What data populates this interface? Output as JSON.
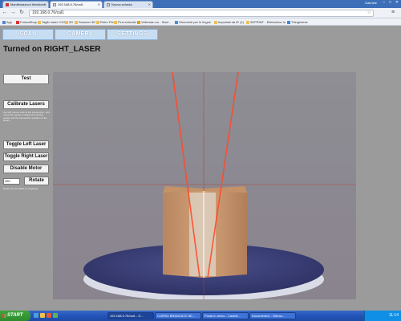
{
  "browser": {
    "tabs": [
      {
        "label": "Manifestazioni fieristiche"
      },
      {
        "label": "192.168.0.76/cal1"
      },
      {
        "label": "Nuova scheda"
      }
    ],
    "user_label": "Gabriele",
    "window_controls": {
      "minimize": "–",
      "maximize": "□",
      "close": "✕"
    },
    "url": "192.168.0.76/cal1",
    "bookmarks": [
      {
        "label": "App"
      },
      {
        "label": "FuturaShop"
      },
      {
        "label": "Taglio laser CO2"
      },
      {
        "label": "3D"
      },
      {
        "label": "Scanner 3D"
      },
      {
        "label": "Retro Pie"
      },
      {
        "label": "PLA extruder"
      },
      {
        "label": "Velleman.eu - Start -"
      },
      {
        "label": "Strumenti per le lingue"
      },
      {
        "label": "Importati da IE (1)"
      },
      {
        "label": "3DPRINT - Elettronica In"
      },
      {
        "label": "Thingiverse"
      }
    ]
  },
  "page": {
    "nav": {
      "scan": "SCAN",
      "camera": "CAMERA",
      "settings": "SETTINGS"
    },
    "status_title": "Turned on RIGHT_LASER",
    "controls": {
      "test": "Test",
      "calibrate": "Calibrate Lasers",
      "calibrate_note": "Use left mouse click at the intersection, and move the mouse to adjust the camera center and the intersection position of the lasers.",
      "toggle_left": "Toggle Left Laser",
      "toggle_right": "Toggle Right Laser",
      "disable_motor": "Disable Motor",
      "degrees_value": "360",
      "rotate": "Rotate",
      "rotate_note": "Rotate the turntable (in degrees)"
    },
    "colors": {
      "laser": "#ff4a2a",
      "crosshair": "#c0392b",
      "nav_button": "#c7ddf2",
      "turntable": "#3a3f7a"
    }
  },
  "taskbar": {
    "start": "START",
    "items": [
      {
        "label": "192.168.0.76/cal1 - G..."
      },
      {
        "label": "CORSO BRANCATO 3D ..."
      },
      {
        "label": "Posta in arrivo - Castell..."
      },
      {
        "label": "Documento1 - Micros..."
      }
    ],
    "clock": "11:14"
  }
}
